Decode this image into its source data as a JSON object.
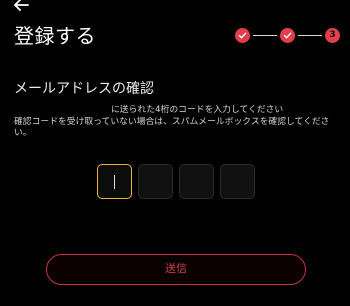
{
  "header": {
    "back_icon": "arrow-left-icon",
    "title": "登録する"
  },
  "stepper": {
    "steps": [
      {
        "state": "done",
        "icon": "check-icon"
      },
      {
        "state": "done",
        "icon": "check-icon"
      },
      {
        "state": "current",
        "label": "3"
      }
    ],
    "accent": "#e0404c"
  },
  "verification": {
    "heading": "メールアドレスの確認",
    "instructions_line1": "に送られた4桁のコードを入力してください",
    "instructions_line2": "確認コードを受け取っていない場合は、スパムメールボックスを確認してくださ",
    "instructions_line3": "い。"
  },
  "code_input": {
    "length": 4,
    "values": [
      "",
      "",
      "",
      ""
    ],
    "active_index": 0,
    "active_color": "#e7b53a"
  },
  "submit": {
    "label": "送信",
    "color": "#c8353f"
  }
}
